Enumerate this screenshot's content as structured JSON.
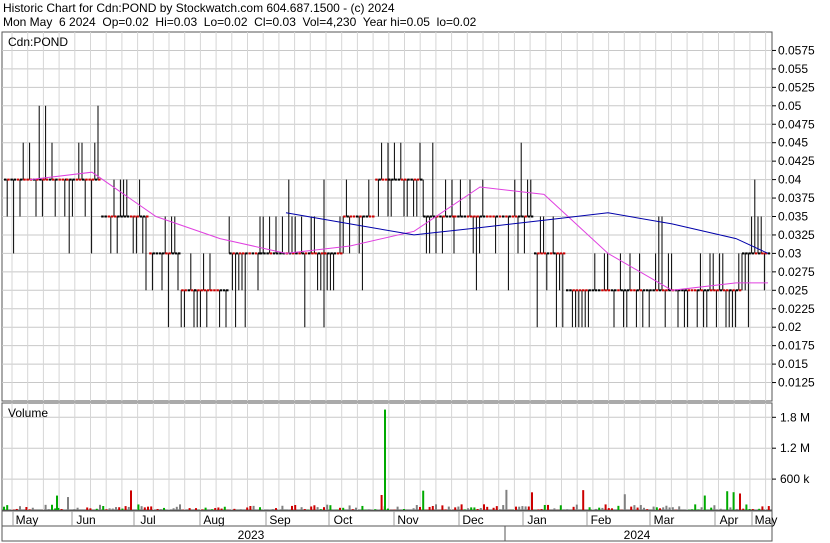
{
  "header": {
    "line1": "Historic Chart for Cdn:POND by Stockwatch.com 604.687.1500 - (c) 2024",
    "line2": "Mon May  6 2024  Op=0.02  Hi=0.03  Lo=0.02  Cl=0.03  Vol=4,230  Year hi=0.05  lo=0.02"
  },
  "chart_data": {
    "type": "ohlc",
    "symbol_label": "Cdn:POND",
    "price_axis": {
      "ylim": [
        0.01,
        0.06
      ],
      "ticks": [
        "0.0575",
        "0.055",
        "0.0525",
        "0.05",
        "0.0475",
        "0.045",
        "0.0425",
        "0.04",
        "0.0375",
        "0.035",
        "0.0325",
        "0.03",
        "0.0275",
        "0.025",
        "0.0225",
        "0.02",
        "0.0175",
        "0.015",
        "0.0125"
      ],
      "grid": true
    },
    "volume_panel": {
      "label": "Volume",
      "ylim": [
        0,
        2000000
      ],
      "ticks": [
        "1.8 M",
        "1.2 M",
        "600 k"
      ],
      "spike_approx": {
        "month": "Oct",
        "value": 1950000
      }
    },
    "x_axis": {
      "months": [
        "May",
        "Jun",
        "Jul",
        "Aug",
        "Sep",
        "Oct",
        "Nov",
        "Dec",
        "Jan",
        "Feb",
        "Mar",
        "Apr",
        "May"
      ],
      "years": [
        "2023",
        "2024"
      ]
    },
    "series": [
      {
        "name": "price",
        "type": "ohlc",
        "x": [
          "May",
          "Jun",
          "Jul",
          "Aug",
          "Sep",
          "Oct",
          "Nov",
          "Dec",
          "Jan",
          "Feb",
          "Mar",
          "Apr",
          "May"
        ],
        "close_approx": [
          0.04,
          0.04,
          0.035,
          0.025,
          0.03,
          0.03,
          0.04,
          0.035,
          0.035,
          0.025,
          0.025,
          0.025,
          0.03
        ]
      },
      {
        "type": "line",
        "color": "#e040e0",
        "values_approx": [
          0.04,
          0.041,
          0.035,
          0.032,
          0.03,
          0.031,
          0.033,
          0.039,
          0.038,
          0.03,
          0.025,
          0.026,
          0.026
        ]
      },
      {
        "type": "line",
        "color": "#0000aa",
        "values_approx": [
          null,
          null,
          null,
          null,
          0.0355,
          0.034,
          0.0325,
          0.0335,
          0.0345,
          0.0355,
          0.034,
          0.032,
          0.03
        ]
      }
    ],
    "colors": {
      "up_candle": "#000000",
      "down_candle": "#cc0000",
      "volume_up": "#00aa00",
      "volume_down": "#cc0000",
      "volume_flat": "#808080",
      "grid": "#c8c8c8"
    }
  }
}
